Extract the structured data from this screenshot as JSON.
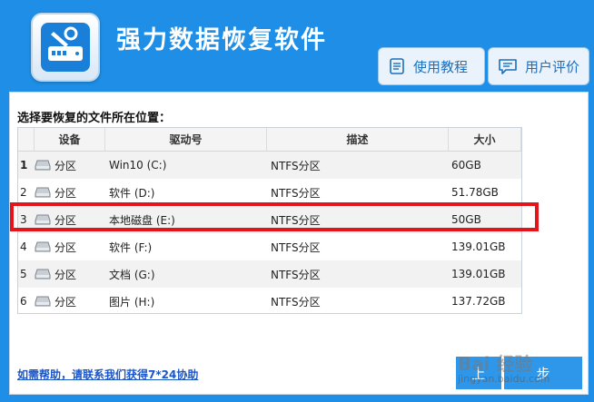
{
  "header": {
    "title": "强力数据恢复软件",
    "buttons": [
      {
        "label": "使用教程",
        "icon": "document-icon"
      },
      {
        "label": "用户评价",
        "icon": "chat-icon"
      }
    ]
  },
  "main": {
    "prompt": "选择要恢复的文件所在位置：",
    "columns": [
      "设备",
      "驱动号",
      "描述",
      "大小"
    ],
    "rows": [
      {
        "num": "1",
        "device": "分区",
        "drive": "Win10 (C:)",
        "desc": "NTFS分区",
        "size": "60GB"
      },
      {
        "num": "2",
        "device": "分区",
        "drive": "软件 (D:)",
        "desc": "NTFS分区",
        "size": "51.78GB"
      },
      {
        "num": "3",
        "device": "分区",
        "drive": "本地磁盘 (E:)",
        "desc": "NTFS分区",
        "size": "50GB"
      },
      {
        "num": "4",
        "device": "分区",
        "drive": "软件 (F:)",
        "desc": "NTFS分区",
        "size": "139.01GB"
      },
      {
        "num": "5",
        "device": "分区",
        "drive": "文档 (G:)",
        "desc": "NTFS分区",
        "size": "139.01GB"
      },
      {
        "num": "6",
        "device": "分区",
        "drive": "图片 (H:)",
        "desc": "NTFS分区",
        "size": "137.72GB"
      }
    ],
    "help_link": "如需帮助，请联系我们获得7*24协助",
    "prev_label": "上",
    "next_label": "步"
  },
  "watermark": {
    "logo": "Bai 经验",
    "text": "jingyan.baidu.com"
  },
  "colors": {
    "accent": "#1e8ee6",
    "highlight": "#e4141b"
  }
}
